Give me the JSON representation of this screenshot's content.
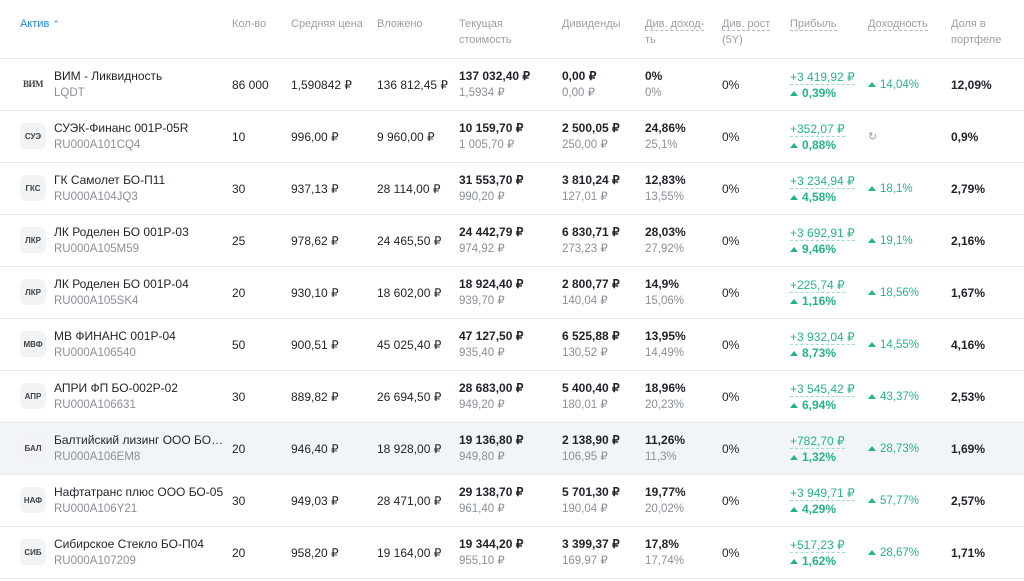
{
  "headers": {
    "asset": "Актив",
    "qty": "Кол-во",
    "avg": "Средняя цена",
    "invested": "Вложено",
    "current1": "Текущая",
    "current2": "стоимость",
    "div": "Дивиденды",
    "divyield1": "Див. доход-",
    "divyield2": "ть",
    "divgrowth1": "Див. рост",
    "divgrowth2": "(5Y)",
    "profit": "Прибыль",
    "yield": "Доходность",
    "share1": "Доля в",
    "share2": "портфеле",
    "sort_icon": "chevron-up-icon"
  },
  "rows": [
    {
      "logo": "ВИМ",
      "name": "ВИМ - Ликвидность",
      "ticker": "LQDT",
      "qty": "86 000",
      "avg": "1,590842 ₽",
      "invested": "136 812,45 ₽",
      "cur": "137 032,40 ₽",
      "cur_sub": "1,5934 ₽",
      "div": "0,00 ₽",
      "div_sub": "0,00 ₽",
      "dy": "0%",
      "dy_sub": "0%",
      "dg": "0%",
      "profit": "+3 419,92 ₽",
      "profit_pct": "0,39%",
      "yield": "14,04%",
      "share": "12,09%"
    },
    {
      "logo": "СУЭ",
      "name": "СУЭК-Финанс 001Р-05R",
      "ticker": "RU000A101CQ4",
      "qty": "10",
      "avg": "996,00 ₽",
      "invested": "9 960,00 ₽",
      "cur": "10 159,70 ₽",
      "cur_sub": "1 005,70 ₽",
      "div": "2 500,05 ₽",
      "div_sub": "250,00 ₽",
      "dy": "24,86%",
      "dy_sub": "25,1%",
      "dg": "0%",
      "profit": "+352,07 ₽",
      "profit_pct": "0,88%",
      "yield": "",
      "share": "0,9%"
    },
    {
      "logo": "ГКС",
      "name": "ГК Самолет БО-П11",
      "ticker": "RU000A104JQ3",
      "qty": "30",
      "avg": "937,13 ₽",
      "invested": "28 114,00 ₽",
      "cur": "31 553,70 ₽",
      "cur_sub": "990,20 ₽",
      "div": "3 810,24 ₽",
      "div_sub": "127,01 ₽",
      "dy": "12,83%",
      "dy_sub": "13,55%",
      "dg": "0%",
      "profit": "+3 234,94 ₽",
      "profit_pct": "4,58%",
      "yield": "18,1%",
      "share": "2,79%"
    },
    {
      "logo": "ЛКР",
      "name": "ЛК Роделен БО 001Р-03",
      "ticker": "RU000A105M59",
      "qty": "25",
      "avg": "978,62 ₽",
      "invested": "24 465,50 ₽",
      "cur": "24 442,79 ₽",
      "cur_sub": "974,92 ₽",
      "div": "6 830,71 ₽",
      "div_sub": "273,23 ₽",
      "dy": "28,03%",
      "dy_sub": "27,92%",
      "dg": "0%",
      "profit": "+3 692,91 ₽",
      "profit_pct": "9,46%",
      "yield": "19,1%",
      "share": "2,16%"
    },
    {
      "logo": "ЛКР",
      "name": "ЛК Роделен БО 001Р-04",
      "ticker": "RU000A105SK4",
      "qty": "20",
      "avg": "930,10 ₽",
      "invested": "18 602,00 ₽",
      "cur": "18 924,40 ₽",
      "cur_sub": "939,70 ₽",
      "div": "2 800,77 ₽",
      "div_sub": "140,04 ₽",
      "dy": "14,9%",
      "dy_sub": "15,06%",
      "dg": "0%",
      "profit": "+225,74 ₽",
      "profit_pct": "1,16%",
      "yield": "18,56%",
      "share": "1,67%"
    },
    {
      "logo": "МВФ",
      "name": "МВ ФИНАНС 001Р-04",
      "ticker": "RU000A106540",
      "qty": "50",
      "avg": "900,51 ₽",
      "invested": "45 025,40 ₽",
      "cur": "47 127,50 ₽",
      "cur_sub": "935,40 ₽",
      "div": "6 525,88 ₽",
      "div_sub": "130,52 ₽",
      "dy": "13,95%",
      "dy_sub": "14,49%",
      "dg": "0%",
      "profit": "+3 932,04 ₽",
      "profit_pct": "8,73%",
      "yield": "14,55%",
      "share": "4,16%"
    },
    {
      "logo": "АПР",
      "name": "АПРИ ФП БО-002Р-02",
      "ticker": "RU000A106631",
      "qty": "30",
      "avg": "889,82 ₽",
      "invested": "26 694,50 ₽",
      "cur": "28 683,00 ₽",
      "cur_sub": "949,20 ₽",
      "div": "5 400,40 ₽",
      "div_sub": "180,01 ₽",
      "dy": "18,96%",
      "dy_sub": "20,23%",
      "dg": "0%",
      "profit": "+3 545,42 ₽",
      "profit_pct": "6,94%",
      "yield": "43,37%",
      "share": "2,53%"
    },
    {
      "logo": "БАЛ",
      "name": "Балтийский лизинг ООО БО-…",
      "ticker": "RU000A106EM8",
      "qty": "20",
      "avg": "946,40 ₽",
      "invested": "18 928,00 ₽",
      "cur": "19 136,80 ₽",
      "cur_sub": "949,80 ₽",
      "div": "2 138,90 ₽",
      "div_sub": "106,95 ₽",
      "dy": "11,26%",
      "dy_sub": "11,3%",
      "dg": "0%",
      "profit": "+782,70 ₽",
      "profit_pct": "1,32%",
      "yield": "28,73%",
      "share": "1,69%"
    },
    {
      "logo": "НАФ",
      "name": "Нафтатранс плюс ООО БО-05",
      "ticker": "RU000A106Y21",
      "qty": "30",
      "avg": "949,03 ₽",
      "invested": "28 471,00 ₽",
      "cur": "29 138,70 ₽",
      "cur_sub": "961,40 ₽",
      "div": "5 701,30 ₽",
      "div_sub": "190,04 ₽",
      "dy": "19,77%",
      "dy_sub": "20,02%",
      "dg": "0%",
      "profit": "+3 949,71 ₽",
      "profit_pct": "4,29%",
      "yield": "57,77%",
      "share": "2,57%"
    },
    {
      "logo": "СИБ",
      "name": "Сибирское Стекло БО-П04",
      "ticker": "RU000A107209",
      "qty": "20",
      "avg": "958,20 ₽",
      "invested": "19 164,00 ₽",
      "cur": "19 344,20 ₽",
      "cur_sub": "955,10 ₽",
      "div": "3 399,37 ₽",
      "div_sub": "169,97 ₽",
      "dy": "17,8%",
      "dy_sub": "17,74%",
      "dg": "0%",
      "profit": "+517,23 ₽",
      "profit_pct": "1,62%",
      "yield": "28,67%",
      "share": "1,71%"
    }
  ],
  "highlight_row": 7,
  "colors": {
    "accent": "#1e88e5",
    "positive": "#26b38a",
    "muted": "#8a9096"
  }
}
